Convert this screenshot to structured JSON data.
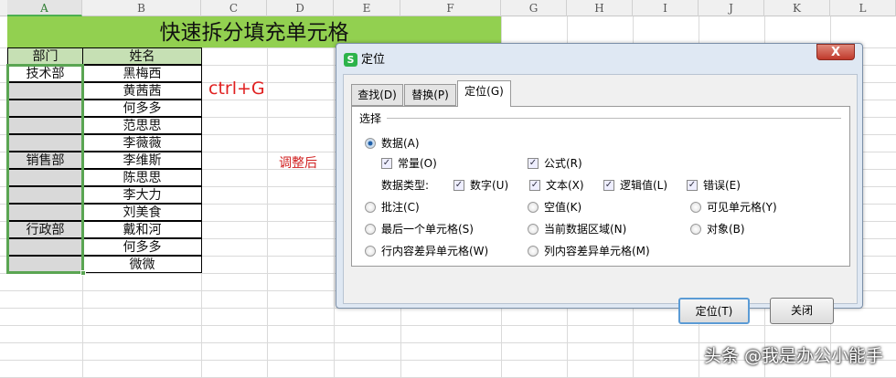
{
  "columns": [
    "A",
    "B",
    "C",
    "D",
    "E",
    "F",
    "G",
    "H",
    "I",
    "J",
    "K",
    "L"
  ],
  "sheet": {
    "title": "快速拆分填充单元格",
    "headers": [
      "部门",
      "姓名"
    ],
    "rows": [
      {
        "dept": "技术部",
        "name": "黑梅西"
      },
      {
        "dept": "",
        "name": "黄茜茜"
      },
      {
        "dept": "",
        "name": "何多多"
      },
      {
        "dept": "",
        "name": "范思思"
      },
      {
        "dept": "",
        "name": "李薇薇"
      },
      {
        "dept": "销售部",
        "name": "李维斯"
      },
      {
        "dept": "",
        "name": "陈思思"
      },
      {
        "dept": "",
        "name": "李大力"
      },
      {
        "dept": "",
        "name": "刘美食"
      },
      {
        "dept": "行政部",
        "name": "戴和河"
      },
      {
        "dept": "",
        "name": "何多多"
      },
      {
        "dept": "",
        "name": "微微"
      }
    ],
    "note_shortcut": "ctrl+G",
    "note_after": "调整后"
  },
  "dialog": {
    "icon": "S",
    "title": "定位",
    "close": "X",
    "tabs": [
      "查找(D)",
      "替换(P)",
      "定位(G)"
    ],
    "group": "选择",
    "data_option": "数据(A)",
    "constants": "常量(O)",
    "formulas": "公式(R)",
    "data_type_label": "数据类型:",
    "types": [
      "数字(U)",
      "文本(X)",
      "逻辑值(L)",
      "错误(E)"
    ],
    "options": [
      "批注(C)",
      "空值(K)",
      "可见单元格(Y)",
      "最后一个单元格(S)",
      "当前数据区域(N)",
      "对象(B)",
      "行内容差异单元格(W)",
      "列内容差异单元格(M)"
    ],
    "ok": "定位(T)",
    "cancel": "关闭"
  },
  "watermark": "头条 @我是办公小能手"
}
